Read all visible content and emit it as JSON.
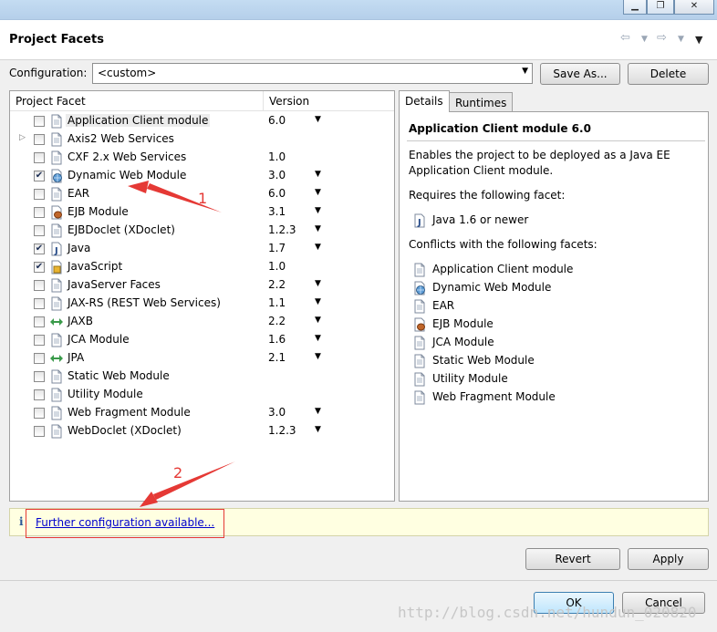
{
  "header": {
    "title": "Project Facets"
  },
  "configuration": {
    "label": "Configuration:",
    "value": "<custom>",
    "save_as_label": "Save As...",
    "delete_label": "Delete"
  },
  "facets_table": {
    "col_facet": "Project Facet",
    "col_version": "Version",
    "rows": [
      {
        "name": "Application Client module",
        "version": "6.0",
        "checked": false,
        "icon": "document-icon"
      },
      {
        "name": "Axis2 Web Services",
        "version": "",
        "checked": false,
        "icon": "document-icon"
      },
      {
        "name": "CXF 2.x Web Services",
        "version": "1.0",
        "checked": false,
        "icon": "document-icon"
      },
      {
        "name": "Dynamic Web Module",
        "version": "3.0",
        "checked": true,
        "icon": "globe-icon"
      },
      {
        "name": "EAR",
        "version": "6.0",
        "checked": false,
        "icon": "document-icon"
      },
      {
        "name": "EJB Module",
        "version": "3.1",
        "checked": false,
        "icon": "bean-icon"
      },
      {
        "name": "EJBDoclet (XDoclet)",
        "version": "1.2.3",
        "checked": false,
        "icon": "document-icon"
      },
      {
        "name": "Java",
        "version": "1.7",
        "checked": true,
        "icon": "java-icon"
      },
      {
        "name": "JavaScript",
        "version": "1.0",
        "checked": true,
        "icon": "javascript-icon"
      },
      {
        "name": "JavaServer Faces",
        "version": "2.2",
        "checked": false,
        "icon": "document-icon"
      },
      {
        "name": "JAX-RS (REST Web Services)",
        "version": "1.1",
        "checked": false,
        "icon": "document-icon"
      },
      {
        "name": "JAXB",
        "version": "2.2",
        "checked": false,
        "icon": "arrows-icon"
      },
      {
        "name": "JCA Module",
        "version": "1.6",
        "checked": false,
        "icon": "document-icon"
      },
      {
        "name": "JPA",
        "version": "2.1",
        "checked": false,
        "icon": "arrows-icon"
      },
      {
        "name": "Static Web Module",
        "version": "",
        "checked": false,
        "icon": "document-icon"
      },
      {
        "name": "Utility Module",
        "version": "",
        "checked": false,
        "icon": "document-icon"
      },
      {
        "name": "Web Fragment Module",
        "version": "3.0",
        "checked": false,
        "icon": "document-icon"
      },
      {
        "name": "WebDoclet (XDoclet)",
        "version": "1.2.3",
        "checked": false,
        "icon": "document-icon"
      }
    ]
  },
  "details": {
    "tab_details": "Details",
    "tab_runtimes": "Runtimes",
    "title": "Application Client module 6.0",
    "desc_line1": "Enables the project to be deployed as a Java EE",
    "desc_line2": "Application Client module.",
    "requires_label": "Requires the following facet:",
    "requires": [
      {
        "name": "Java 1.6 or newer",
        "icon": "java-icon"
      }
    ],
    "conflicts_label": "Conflicts with the following facets:",
    "conflicts": [
      {
        "name": "Application Client module",
        "icon": "document-icon"
      },
      {
        "name": "Dynamic Web Module",
        "icon": "globe-icon"
      },
      {
        "name": "EAR",
        "icon": "document-icon"
      },
      {
        "name": "EJB Module",
        "icon": "bean-icon"
      },
      {
        "name": "JCA Module",
        "icon": "document-icon"
      },
      {
        "name": "Static Web Module",
        "icon": "document-icon"
      },
      {
        "name": "Utility Module",
        "icon": "document-icon"
      },
      {
        "name": "Web Fragment Module",
        "icon": "document-icon"
      }
    ]
  },
  "info_bar": {
    "link": "Further configuration available..."
  },
  "annotations": {
    "one": "1",
    "two": "2"
  },
  "buttons": {
    "revert": "Revert",
    "apply": "Apply",
    "ok": "OK",
    "cancel": "Cancel"
  },
  "watermark": "http://blog.csdn.net/hundun_020820"
}
